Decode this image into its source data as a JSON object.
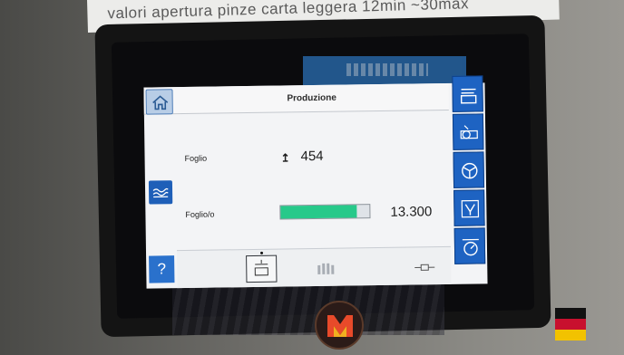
{
  "photo": {
    "paper_label": "valori apertura pinze carta leggera 12min ~30max"
  },
  "screen": {
    "title": "Produzione",
    "rows": [
      {
        "label": "Foglio",
        "value": "454",
        "icon": "sheet-counter-icon"
      },
      {
        "label": "Foglio/o",
        "value": "13.300",
        "progress_fraction": 0.86
      }
    ],
    "help_label": "?",
    "left_buttons": [
      "home-icon",
      "waves-icon",
      "help-icon"
    ],
    "right_buttons": [
      "feeder-icon",
      "printing-unit-icon",
      "steering-wheel-icon",
      "gripper-icon",
      "speed-gauge-icon"
    ],
    "bottom_tabs": [
      "stack-tab-icon",
      "columns-tab-icon",
      "transfer-tab-icon"
    ]
  },
  "colors": {
    "accent_blue": "#1e63c2",
    "progress_green": "#27c98a",
    "screen_bg": "#f3f4f6"
  }
}
